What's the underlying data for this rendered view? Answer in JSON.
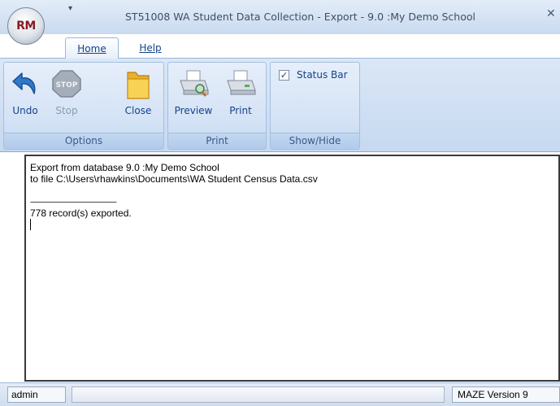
{
  "window": {
    "title": "ST51008 WA Student Data Collection - Export - 9.0 :My Demo School",
    "app_logo_text": "RM",
    "qat_icon": "dropdown-arrow-icon",
    "close_icon": "close-icon"
  },
  "tabs": [
    {
      "label": "Home",
      "access_key": "H",
      "selected": true
    },
    {
      "label": "Help",
      "access_key": "H",
      "selected": false
    }
  ],
  "ribbon": {
    "groups": [
      {
        "label": "Options",
        "buttons": [
          {
            "label": "Undo",
            "icon": "undo-arrow-icon",
            "enabled": true
          },
          {
            "label": "Stop",
            "icon": "stop-sign-icon",
            "enabled": false,
            "icon_text": "STOP"
          },
          {
            "label": "Close",
            "icon": "folder-icon",
            "enabled": true
          }
        ]
      },
      {
        "label": "Print",
        "buttons": [
          {
            "label": "Preview",
            "icon": "print-preview-icon",
            "enabled": true
          },
          {
            "label": "Print",
            "icon": "printer-icon",
            "enabled": true
          }
        ]
      },
      {
        "label": "Show/Hide",
        "checkboxes": [
          {
            "label": "Status Bar",
            "checked": true
          }
        ]
      }
    ]
  },
  "log": {
    "lines": [
      "Export from database 9.0 :My Demo School",
      "to file C:\\Users\\rhawkins\\Documents\\WA Student Census Data.csv",
      "",
      "-----------------------------------------------------",
      "778 record(s) exported."
    ]
  },
  "statusbar": {
    "user": "admin",
    "version": "MAZE Version 9"
  },
  "colors": {
    "ribbon_text": "#15428b",
    "ribbon_bg": "#d3e2f5",
    "disabled_text": "#8d9bb0"
  }
}
